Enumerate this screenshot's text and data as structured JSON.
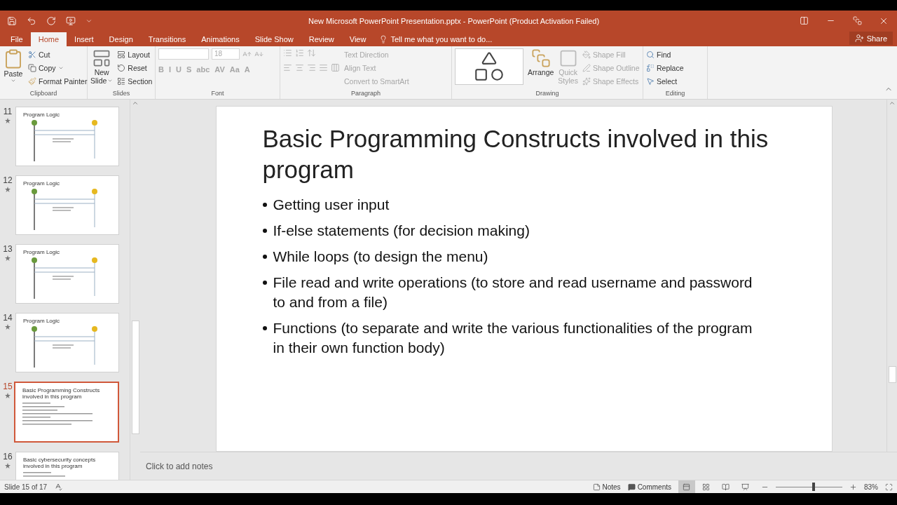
{
  "window": {
    "title": "New Microsoft PowerPoint Presentation.pptx - PowerPoint (Product Activation Failed)"
  },
  "tabs": [
    {
      "label": "File",
      "selected": false
    },
    {
      "label": "Home",
      "selected": true
    },
    {
      "label": "Insert",
      "selected": false
    },
    {
      "label": "Design",
      "selected": false
    },
    {
      "label": "Transitions",
      "selected": false
    },
    {
      "label": "Animations",
      "selected": false
    },
    {
      "label": "Slide Show",
      "selected": false
    },
    {
      "label": "Review",
      "selected": false
    },
    {
      "label": "View",
      "selected": false
    }
  ],
  "tell_me": "Tell me what you want to do...",
  "share": "Share",
  "clipboard": {
    "label": "Clipboard",
    "paste": "Paste",
    "cut": "Cut",
    "copy": "Copy",
    "format_painter": "Format Painter"
  },
  "slides_group": {
    "label": "Slides",
    "new_slide": [
      "New",
      "Slide"
    ],
    "layout": "Layout",
    "reset": "Reset",
    "section": "Section"
  },
  "font": {
    "label": "Font",
    "disabled": true,
    "size": "18",
    "format_buttons": [
      "B",
      "I",
      "U",
      "S",
      "abc",
      "AV",
      "Aa",
      "A"
    ]
  },
  "paragraph": {
    "label": "Paragraph",
    "items": [
      {
        "label": "Text Direction",
        "disabled": true
      },
      {
        "label": "Align Text",
        "disabled": true
      },
      {
        "label": "Convert to SmartArt",
        "disabled": true
      }
    ]
  },
  "drawing": {
    "label": "Drawing",
    "arrange": "Arrange",
    "quick_styles": [
      "Quick",
      "Styles"
    ],
    "items": [
      {
        "label": "Shape Fill",
        "disabled": true
      },
      {
        "label": "Shape Outline",
        "disabled": true
      },
      {
        "label": "Shape Effects",
        "disabled": true
      }
    ]
  },
  "editing": {
    "label": "Editing",
    "items": [
      {
        "label": "Find",
        "kind": "find"
      },
      {
        "label": "Replace",
        "kind": "replace"
      },
      {
        "label": "Select",
        "kind": "select"
      }
    ]
  },
  "thumbnails": [
    {
      "number": "11",
      "title": "Program Logic",
      "kind": "diagram",
      "selected": false
    },
    {
      "number": "12",
      "title": "Program Logic",
      "kind": "diagram",
      "selected": false
    },
    {
      "number": "13",
      "title": "Program Logic",
      "kind": "diagram",
      "selected": false
    },
    {
      "number": "14",
      "title": "Program Logic",
      "kind": "diagram",
      "selected": false
    },
    {
      "number": "15",
      "title": "Basic Programming Constructs involved in this program",
      "kind": "text",
      "selected": true
    },
    {
      "number": "16",
      "title": "Basic cybersecurity concepts involved in this program",
      "kind": "text",
      "selected": false
    }
  ],
  "slide": {
    "title": "Basic Programming Constructs involved in this program",
    "bullets": [
      "Getting user input",
      "If-else statements (for decision making)",
      "While loops (to design the menu)",
      "File read and write operations (to store and read username and password to and from a file)",
      "Functions (to separate and write the various functionalities of the program in their own function body)"
    ]
  },
  "notes_placeholder": "Click to add notes",
  "status": {
    "slide": "Slide 15 of 17",
    "notes": "Notes",
    "comments": "Comments",
    "zoom": "83%",
    "zoom_slider": {
      "level": 0.55
    },
    "views": [
      {
        "kind": "normal",
        "selected": true
      },
      {
        "kind": "sorter",
        "selected": false
      },
      {
        "kind": "reading",
        "selected": false
      },
      {
        "kind": "slideshow",
        "selected": false
      }
    ]
  }
}
